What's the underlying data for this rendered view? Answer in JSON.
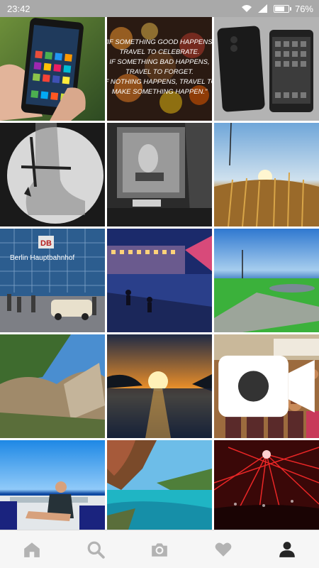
{
  "status_bar": {
    "time": "23:42",
    "battery": "76%",
    "battery_level": 0.76,
    "icons": [
      "wifi-icon",
      "signal-icon",
      "battery-icon"
    ]
  },
  "grid": {
    "items": [
      {
        "kind": "photo",
        "subject": "phone-in-hand"
      },
      {
        "kind": "photo",
        "subject": "quote-bokeh",
        "text_lines": [
          "\"IF SOMETHING GOOD HAPPENS,",
          "TRAVEL TO CELEBRATE.",
          "IF SOMETHING BAD HAPPENS,",
          "TRAVEL TO FORGET.",
          "IF NOTHING HAPPENS, TRAVEL TO",
          "MAKE SOMETHING HAPPEN.\""
        ]
      },
      {
        "kind": "photo",
        "subject": "two-phones-bw"
      },
      {
        "kind": "photo",
        "subject": "xray-ankle"
      },
      {
        "kind": "photo",
        "subject": "ambulance-bw"
      },
      {
        "kind": "photo",
        "subject": "wheat-sunset"
      },
      {
        "kind": "photo",
        "subject": "berlin-station",
        "text_lines": [
          "DB",
          "Berlin Hauptbahnhof"
        ]
      },
      {
        "kind": "photo",
        "subject": "night-plaza"
      },
      {
        "kind": "photo",
        "subject": "park-fountain"
      },
      {
        "kind": "photo",
        "subject": "rocky-cliff"
      },
      {
        "kind": "photo",
        "subject": "sea-sunset"
      },
      {
        "kind": "video",
        "subject": "beach-party"
      },
      {
        "kind": "photo",
        "subject": "man-on-terrace"
      },
      {
        "kind": "photo",
        "subject": "turquoise-bay"
      },
      {
        "kind": "photo",
        "subject": "red-laser-club"
      }
    ]
  },
  "bottom_nav": {
    "items": [
      {
        "icon": "home-icon",
        "active": false
      },
      {
        "icon": "search-icon",
        "active": false
      },
      {
        "icon": "camera-icon",
        "active": false
      },
      {
        "icon": "heart-icon",
        "active": false
      },
      {
        "icon": "profile-icon",
        "active": true
      }
    ]
  },
  "colors": {
    "status_bar_bg": "#a9a9a9",
    "nav_bg": "#f6f6f6",
    "nav_icon_inactive": "#b3b3b3",
    "nav_icon_active": "#262626"
  }
}
